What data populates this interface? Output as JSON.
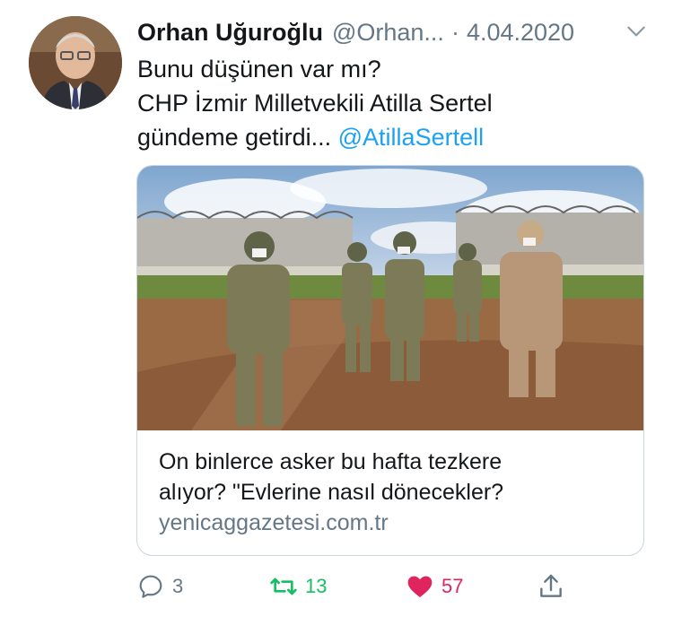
{
  "tweet": {
    "author_name": "Orhan Uğuroğlu",
    "author_handle": "@Orhan...",
    "separator": "·",
    "date": "4.04.2020",
    "text_lines": [
      "Bunu düşünen var mı?",
      "CHP İzmir Milletvekili Atilla Sertel",
      "gündeme getirdi... "
    ],
    "mention": "@AtillaSertell"
  },
  "card": {
    "title_lines": [
      "On binlerce asker bu hafta tezkere",
      "alıyor? \"Evlerine nasıl dönecekler?"
    ],
    "domain": "yenicaggazetesi.com.tr"
  },
  "actions": {
    "reply_count": "3",
    "retweet_count": "13",
    "like_count": "57"
  },
  "icons": {
    "avatar": "author-avatar",
    "menu": "chevron-down-icon",
    "reply": "reply-icon",
    "retweet": "retweet-icon",
    "like": "heart-icon",
    "share": "share-icon"
  },
  "colors": {
    "link": "#1da1f2",
    "muted": "#657786",
    "retweet": "#17bf63",
    "like": "#e0245e"
  }
}
